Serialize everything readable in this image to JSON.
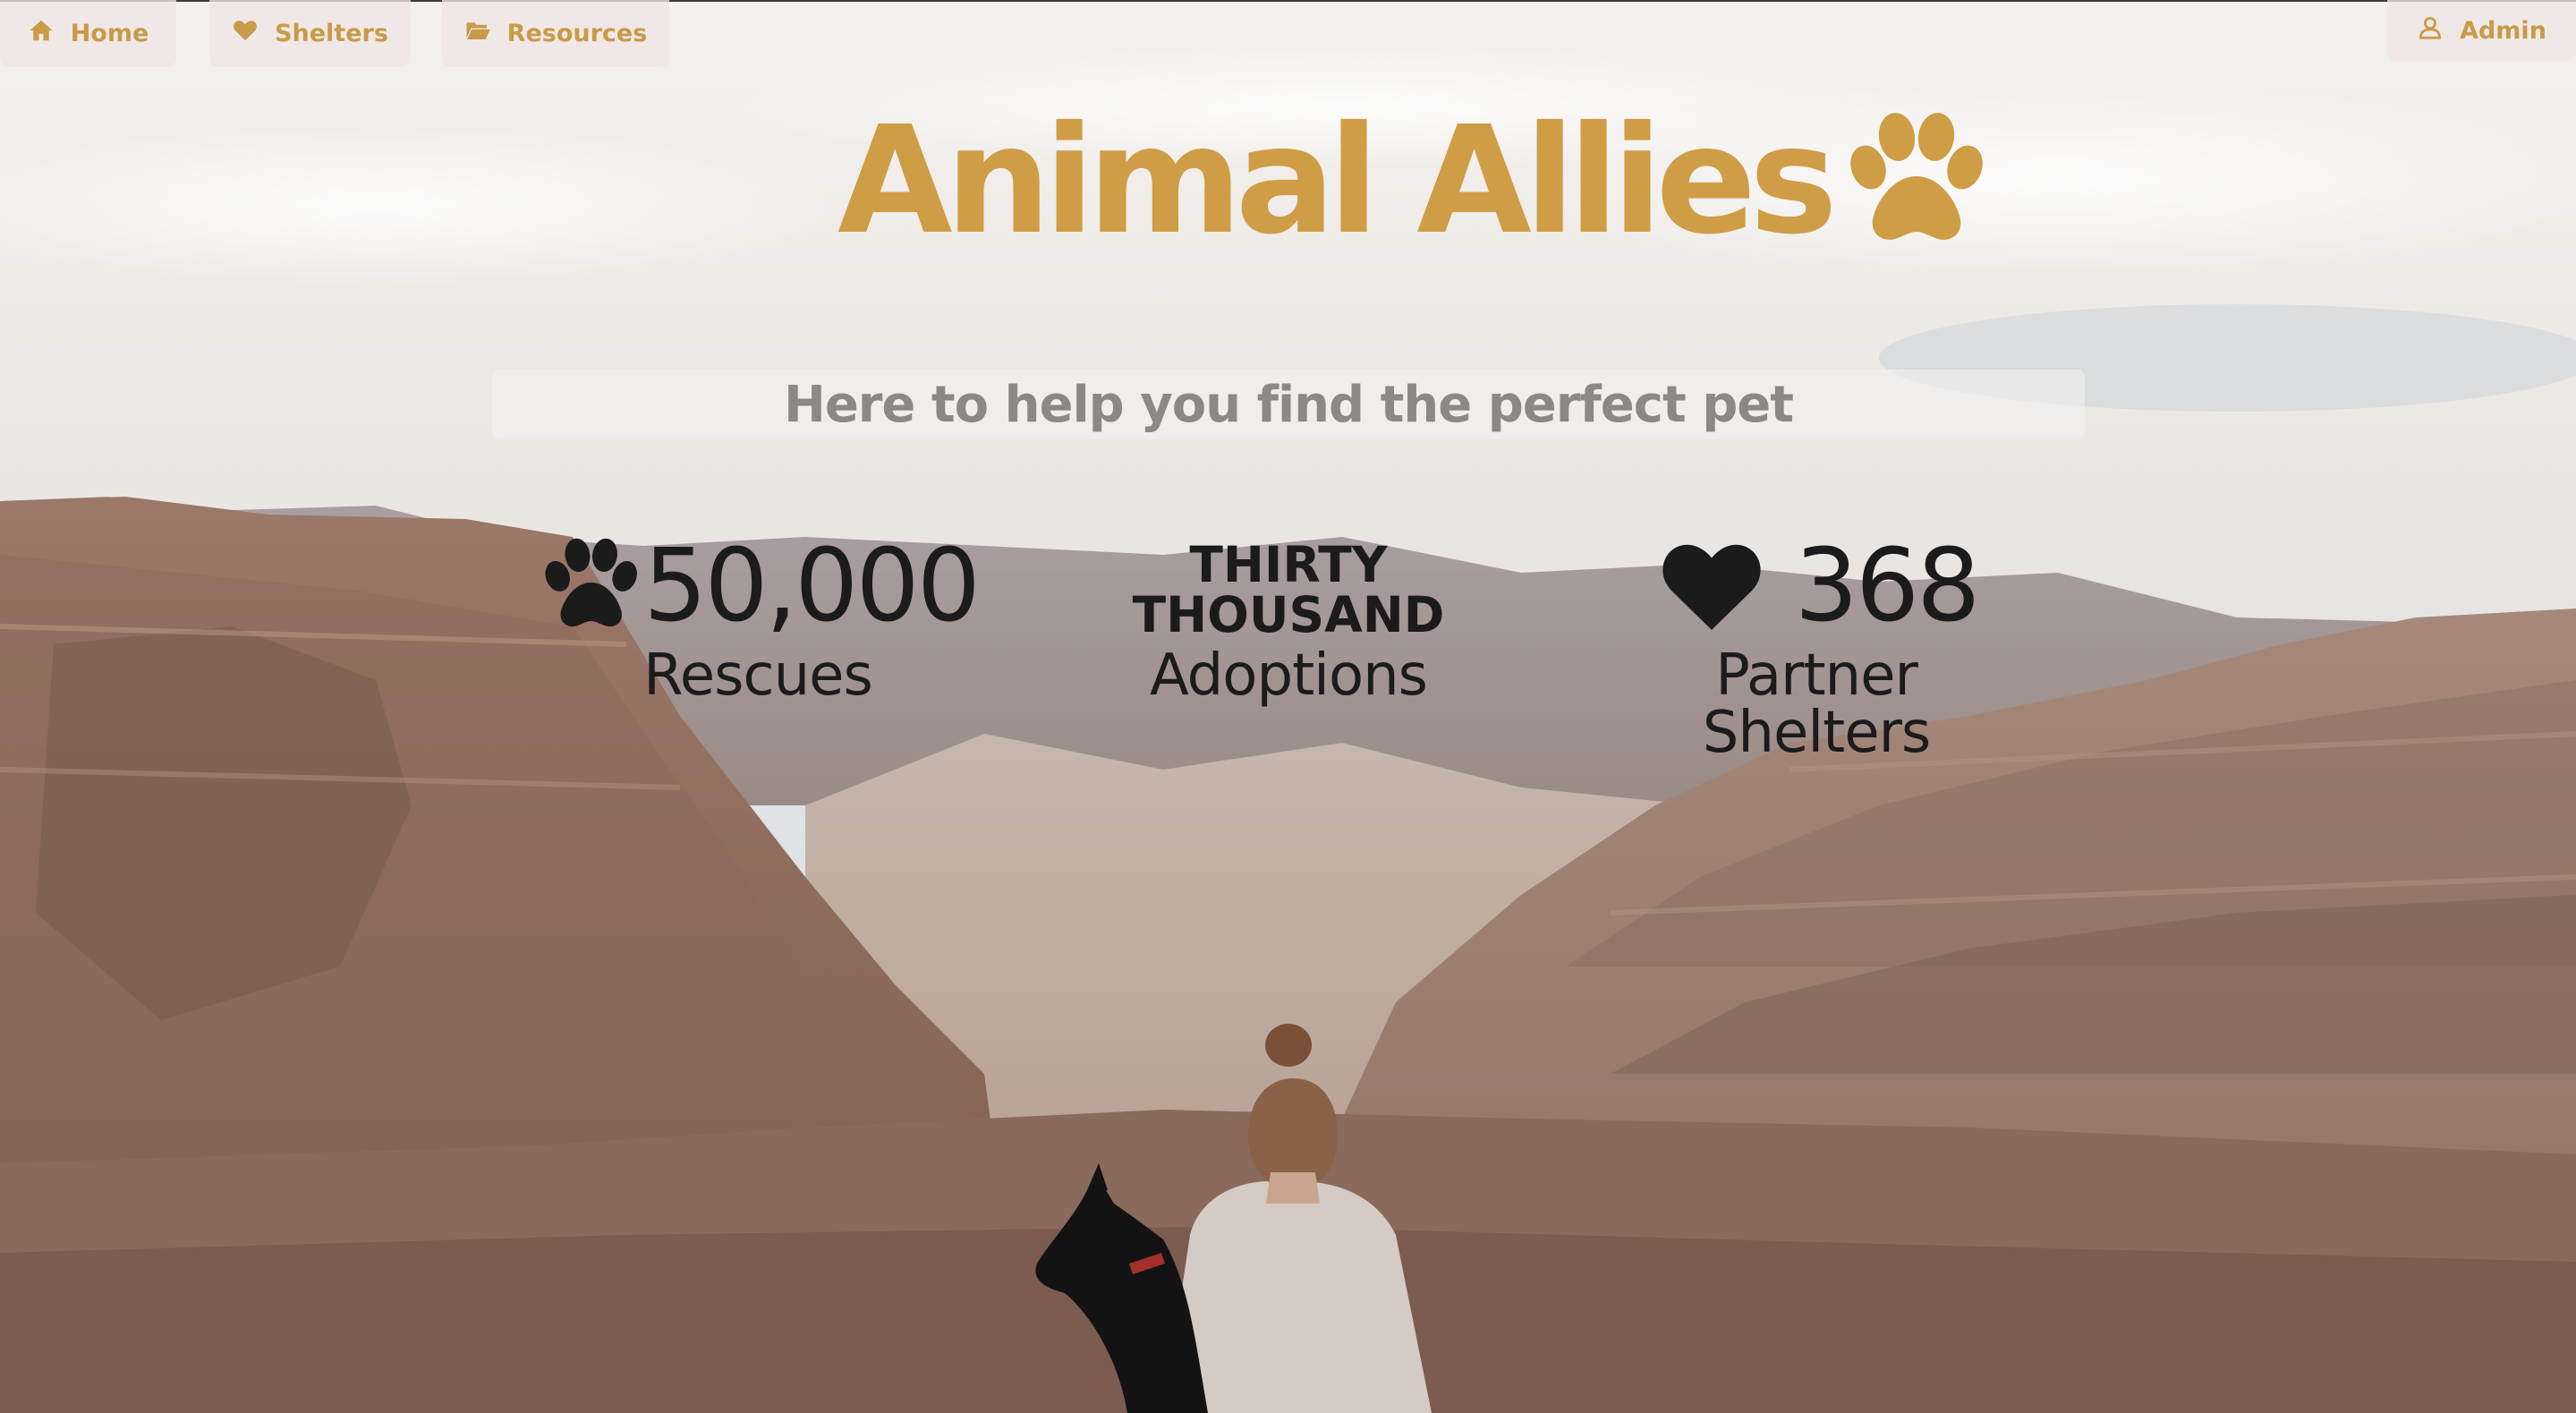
{
  "nav": {
    "home": {
      "label": "Home",
      "icon": "home-icon"
    },
    "shelters": {
      "label": "Shelters",
      "icon": "heart-icon"
    },
    "resources": {
      "label": "Resources",
      "icon": "folder-open-icon"
    },
    "admin": {
      "label": "Admin",
      "icon": "user-icon"
    }
  },
  "brand": {
    "title": "Animal Allies",
    "icon": "paw-icon",
    "color": "#cf9d45"
  },
  "tagline": "Here to help you find the perfect pet",
  "stats": {
    "rescues": {
      "value": "50,000",
      "label": "Rescues",
      "icon": "paw-icon"
    },
    "adoptions": {
      "value": "THIRTY\nTHOUSAND",
      "label": "Adoptions"
    },
    "shelters": {
      "value": "368",
      "label": "Partner Shelters",
      "icon": "heart-icon"
    }
  },
  "colors": {
    "accent": "#c99a47",
    "text_dark": "#1b1b1c",
    "tagline_text": "#8b8886"
  }
}
